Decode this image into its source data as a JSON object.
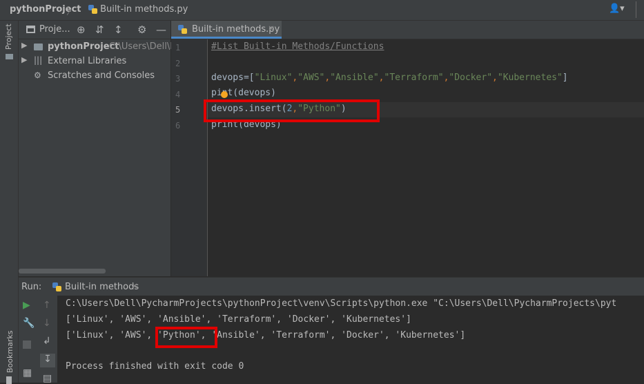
{
  "navbar": {
    "project": "pythonProject",
    "separator": "〉",
    "file": "Built-in methods.py"
  },
  "sidebar": {
    "project_label": "Project",
    "bookmarks_label": "Bookmarks"
  },
  "project_panel": {
    "title": "Proje...",
    "tree": [
      {
        "label": "pythonProject",
        "path": "C:\\Users\\Dell\\Py"
      },
      {
        "label": "External Libraries"
      },
      {
        "label": "Scratches and Consoles"
      }
    ]
  },
  "editor": {
    "tab_label": "Built-in methods.py",
    "tab_close": "×",
    "line_numbers": [
      "1",
      "2",
      "3",
      "4",
      "5",
      "6"
    ],
    "lines": {
      "l1": "#List Built-in Methods/Functions",
      "l3_name": "devops",
      "l3_eq": "=[",
      "l3_s1": "\"Linux\"",
      "l3_s2": "\"AWS\"",
      "l3_s3": "\"Ansible\"",
      "l3_s4": "\"Terraform\"",
      "l3_s5": "\"Docker\"",
      "l3_s6": "\"Kubernetes\"",
      "l3_end": "]",
      "comma": ",",
      "l4_a": "p",
      "l4_b": "int(devops)",
      "l5_a": "devops.insert(",
      "l5_num": "2",
      "l5_str": "\"Python\"",
      "l5_end": ")",
      "l6": "print(devops)"
    }
  },
  "run_panel": {
    "run_label": "Run:",
    "tab_label": "Built-in methods",
    "tab_close": "×",
    "output": [
      "C:\\Users\\Dell\\PycharmProjects\\pythonProject\\venv\\Scripts\\python.exe \"C:\\Users\\Dell\\PycharmProjects\\pyt",
      "['Linux', 'AWS', 'Ansible', 'Terraform', 'Docker', 'Kubernetes']",
      "['Linux', 'AWS', 'Python', 'Ansible', 'Terraform', 'Docker', 'Kubernetes']",
      "",
      "Process finished with exit code 0"
    ]
  },
  "colors": {
    "accent": "#4a88c7",
    "highlight_box": "#e00000",
    "string": "#6a8759",
    "keyword_comma": "#cc7832",
    "number": "#6897bb",
    "run_green": "#499c54"
  }
}
